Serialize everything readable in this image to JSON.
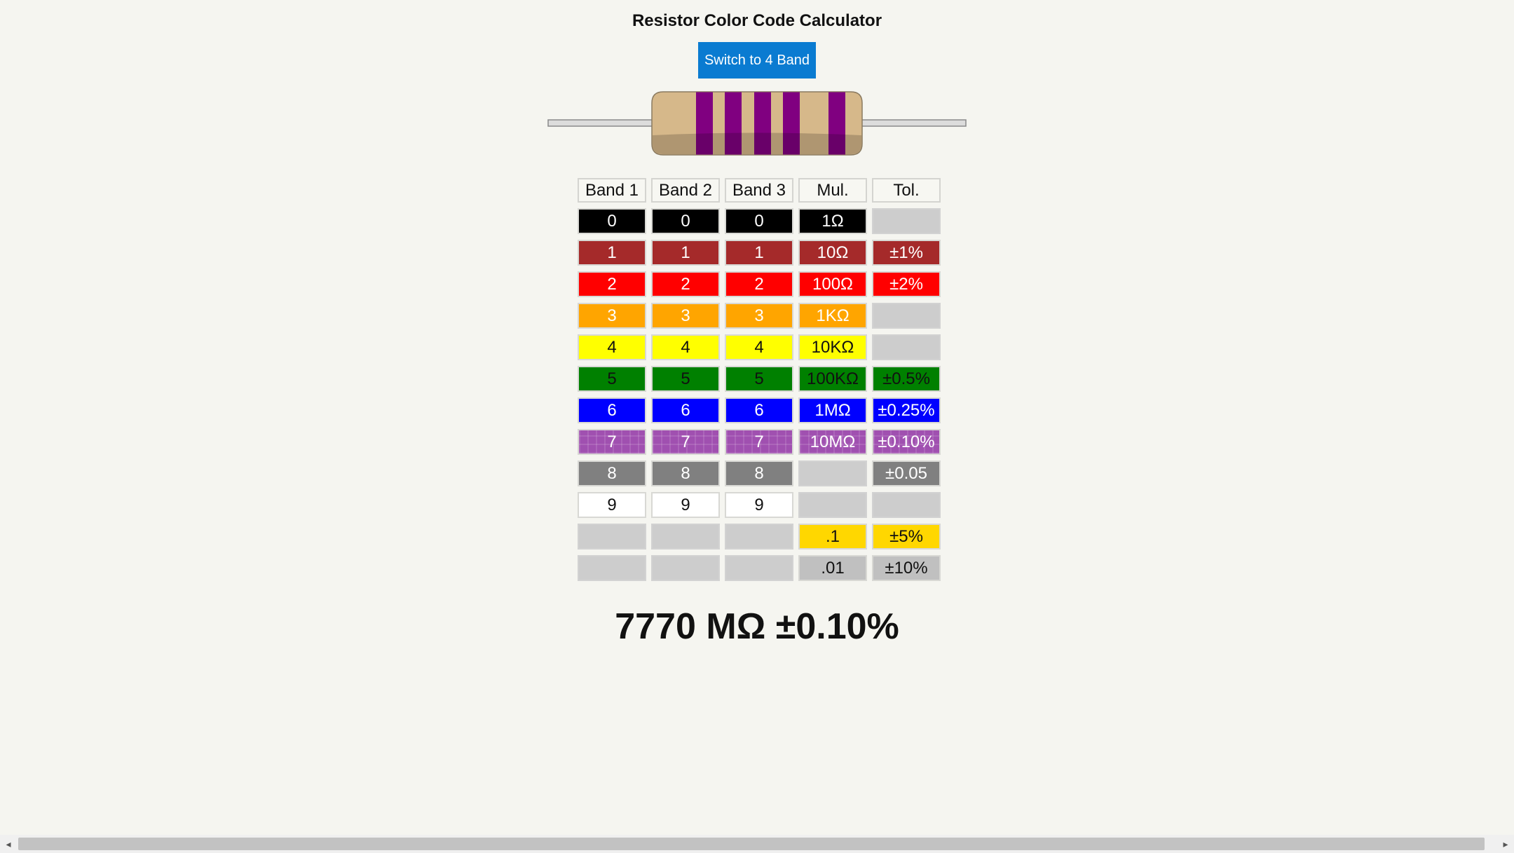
{
  "app": {
    "title": "Resistor Color Code Calculator",
    "switch_button": "Switch to 4 Band",
    "result": "7770 MΩ ±0.10%"
  },
  "resistor": {
    "body_color": "#d6b88a",
    "lead_color": "#dcdcdc",
    "bands": [
      "#800080",
      "#800080",
      "#800080",
      "#800080",
      "#800080"
    ]
  },
  "table": {
    "headers": [
      "Band 1",
      "Band 2",
      "Band 3",
      "Mul.",
      "Tol."
    ],
    "rows": [
      {
        "color": "#000000",
        "text_color": "#ffffff",
        "cells": [
          "0",
          "0",
          "0",
          "1Ω",
          null
        ]
      },
      {
        "color": "#a52a2a",
        "text_color": "#ffffff",
        "cells": [
          "1",
          "1",
          "1",
          "10Ω",
          "±1%"
        ]
      },
      {
        "color": "#ff0000",
        "text_color": "#ffffff",
        "cells": [
          "2",
          "2",
          "2",
          "100Ω",
          "±2%"
        ]
      },
      {
        "color": "#ffa500",
        "text_color": "#ffffff",
        "cells": [
          "3",
          "3",
          "3",
          "1KΩ",
          null
        ]
      },
      {
        "color": "#ffff00",
        "text_color": "#111111",
        "cells": [
          "4",
          "4",
          "4",
          "10KΩ",
          null
        ]
      },
      {
        "color": "#008000",
        "text_color": "#111111",
        "cells": [
          "5",
          "5",
          "5",
          "100KΩ",
          "±0.5%"
        ]
      },
      {
        "color": "#0000ff",
        "text_color": "#ffffff",
        "cells": [
          "6",
          "6",
          "6",
          "1MΩ",
          "±0.25%"
        ]
      },
      {
        "color": "#a050b0",
        "text_color": "#ffffff",
        "cells": [
          "7",
          "7",
          "7",
          "10MΩ",
          "±0.10%"
        ]
      },
      {
        "color": "#808080",
        "text_color": "#ffffff",
        "cells": [
          "8",
          "8",
          "8",
          null,
          "±0.05"
        ]
      },
      {
        "color": "#ffffff",
        "text_color": "#111111",
        "cells": [
          "9",
          "9",
          "9",
          null,
          null
        ]
      },
      {
        "color": "#ffd700",
        "text_color": "#111111",
        "cells": [
          null,
          null,
          null,
          ".1",
          "±5%"
        ]
      },
      {
        "color": "#c0c0c0",
        "text_color": "#111111",
        "cells": [
          null,
          null,
          null,
          ".01",
          "±10%"
        ]
      }
    ]
  }
}
